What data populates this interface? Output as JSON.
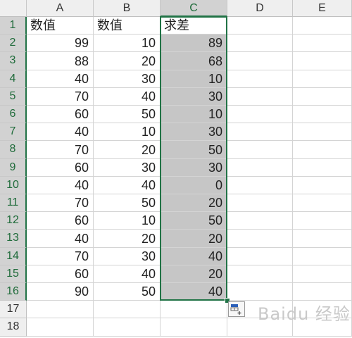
{
  "columns": [
    "A",
    "B",
    "C",
    "D",
    "E"
  ],
  "selected_column": "C",
  "rows": [
    {
      "n": "1",
      "a": "数值",
      "b": "数值",
      "c": "求差"
    },
    {
      "n": "2",
      "a": "99",
      "b": "10",
      "c": "89"
    },
    {
      "n": "3",
      "a": "88",
      "b": "20",
      "c": "68"
    },
    {
      "n": "4",
      "a": "40",
      "b": "30",
      "c": "10"
    },
    {
      "n": "5",
      "a": "70",
      "b": "40",
      "c": "30"
    },
    {
      "n": "6",
      "a": "60",
      "b": "50",
      "c": "10"
    },
    {
      "n": "7",
      "a": "40",
      "b": "10",
      "c": "30"
    },
    {
      "n": "8",
      "a": "70",
      "b": "20",
      "c": "50"
    },
    {
      "n": "9",
      "a": "60",
      "b": "30",
      "c": "30"
    },
    {
      "n": "10",
      "a": "40",
      "b": "40",
      "c": "0"
    },
    {
      "n": "11",
      "a": "70",
      "b": "50",
      "c": "20"
    },
    {
      "n": "12",
      "a": "60",
      "b": "10",
      "c": "50"
    },
    {
      "n": "13",
      "a": "40",
      "b": "20",
      "c": "20"
    },
    {
      "n": "14",
      "a": "70",
      "b": "30",
      "c": "40"
    },
    {
      "n": "15",
      "a": "60",
      "b": "40",
      "c": "20"
    },
    {
      "n": "16",
      "a": "90",
      "b": "50",
      "c": "40"
    },
    {
      "n": "17",
      "a": "",
      "b": "",
      "c": ""
    },
    {
      "n": "18",
      "a": "",
      "b": "",
      "c": ""
    }
  ],
  "selection": {
    "range": "C1:C16",
    "active_cell": "C1"
  },
  "quick_analysis_icon": "quick-analysis-icon",
  "colors": {
    "selection_border": "#217346",
    "selected_fill": "#c6c6c6",
    "header_bg": "#efefef"
  },
  "watermark": "Baidu 经验"
}
